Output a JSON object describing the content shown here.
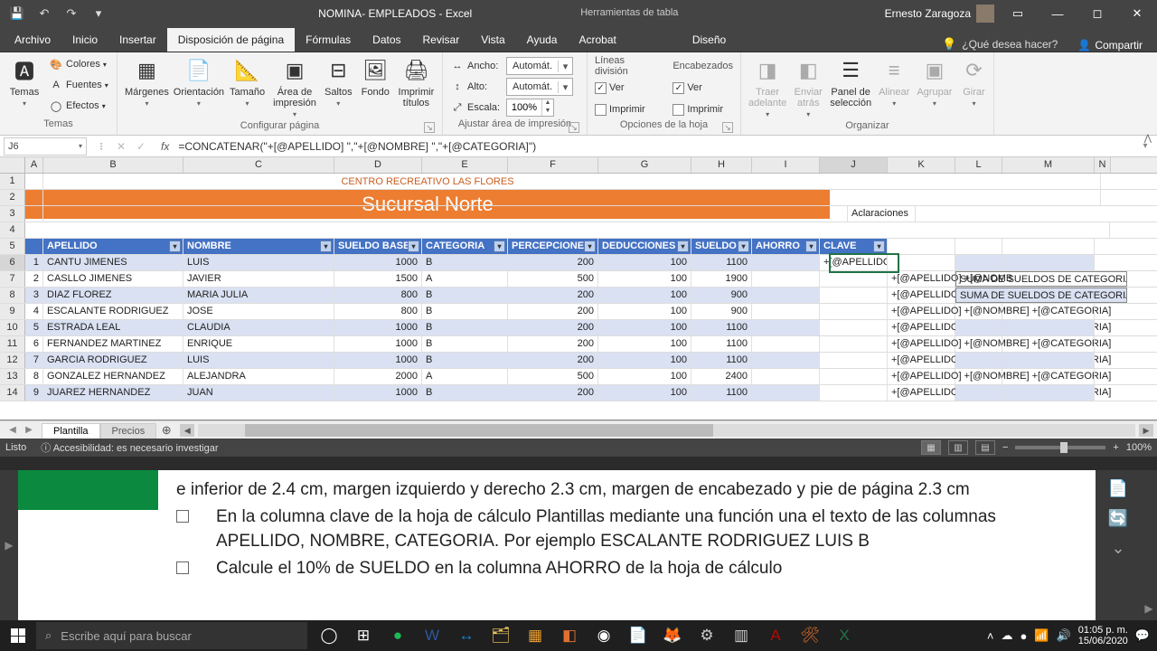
{
  "title": "NOMINA- EMPLEADOS - Excel",
  "tabTools": "Herramientas de tabla",
  "user": "Ernesto Zaragoza",
  "ribbonTabs": {
    "file": "Archivo",
    "home": "Inicio",
    "insert": "Insertar",
    "pageLayout": "Disposición de página",
    "formulas": "Fórmulas",
    "data": "Datos",
    "review": "Revisar",
    "view": "Vista",
    "help": "Ayuda",
    "acrobat": "Acrobat",
    "design": "Diseño"
  },
  "tellMe": "¿Qué desea hacer?",
  "share": "Compartir",
  "ribbon": {
    "themes": {
      "label": "Temas",
      "themes": "Temas",
      "colors": "Colores",
      "fonts": "Fuentes",
      "effects": "Efectos"
    },
    "pageSetup": {
      "label": "Configurar página",
      "margins": "Márgenes",
      "orientation": "Orientación",
      "size": "Tamaño",
      "printArea": "Área de\nimpresión",
      "breaks": "Saltos",
      "background": "Fondo",
      "printTitles": "Imprimir\ntítulos"
    },
    "scaleToFit": {
      "label": "Ajustar área de impresión",
      "width": "Ancho:",
      "height": "Alto:",
      "scale": "Escala:",
      "auto": "Automát.",
      "scaleVal": "100%"
    },
    "sheetOptions": {
      "label": "Opciones de la hoja",
      "gridlines": "Líneas división",
      "headings": "Encabezados",
      "view": "Ver",
      "print": "Imprimir"
    },
    "arrange": {
      "label": "Organizar",
      "bringForward": "Traer\nadelante",
      "sendBackward": "Enviar\natrás",
      "selectionPane": "Panel de\nselección",
      "align": "Alinear",
      "group": "Agrupar",
      "rotate": "Girar"
    }
  },
  "nameBox": "J6",
  "formula": "=CONCATENAR(\"+[@APELLIDO] \",\"+[@NOMBRE] \",\"+[@CATEGORIA]\")",
  "cols": [
    "A",
    "B",
    "C",
    "D",
    "E",
    "F",
    "G",
    "H",
    "I",
    "J",
    "K",
    "L",
    "M",
    "N"
  ],
  "banner1": "CENTRO RECREATIVO LAS FLORES",
  "banner2": "Sucursal Norte",
  "aclaraciones": "Aclaraciones",
  "headers": {
    "apellido": "APELLIDO",
    "nombre": "NOMBRE",
    "sueldoBase": "SUELDO BASE",
    "categoria": "CATEGORIA",
    "percepciones": "PERCEPCIONES",
    "deducciones": "DEDUCCIONES",
    "sueldo": "SUELDO",
    "ahorro": "AHORRO",
    "clave": "CLAVE"
  },
  "sumaNote": "SUMA DE SUELDOS DE CATEGORIA",
  "data": [
    {
      "n": "1",
      "apellido": "CANTU JIMENES",
      "nombre": "LUIS",
      "sb": "1000",
      "cat": "B",
      "per": "200",
      "ded": "100",
      "sueldo": "1100",
      "clave": "+[@APELLIDO] +[@NOMBRE] +[@CATEGORIA]"
    },
    {
      "n": "2",
      "apellido": "CASLLO JIMENES",
      "nombre": "JAVIER",
      "sb": "1500",
      "cat": "A",
      "per": "500",
      "ded": "100",
      "sueldo": "1900",
      "clave": "+[@APELLIDO] +[@NOMB"
    },
    {
      "n": "3",
      "apellido": "DIAZ FLOREZ",
      "nombre": "MARIA JULIA",
      "sb": "800",
      "cat": "B",
      "per": "200",
      "ded": "100",
      "sueldo": "900",
      "clave": "+[@APELLIDO] +[@NOMB"
    },
    {
      "n": "4",
      "apellido": "ESCALANTE RODRIGUEZ",
      "nombre": "JOSE",
      "sb": "800",
      "cat": "B",
      "per": "200",
      "ded": "100",
      "sueldo": "900",
      "clave": "+[@APELLIDO] +[@NOMBRE] +[@CATEGORIA]"
    },
    {
      "n": "5",
      "apellido": "ESTRADA LEAL",
      "nombre": "CLAUDIA",
      "sb": "1000",
      "cat": "B",
      "per": "200",
      "ded": "100",
      "sueldo": "1100",
      "clave": "+[@APELLIDO] +[@NOMBRE] +[@CATEGORIA]"
    },
    {
      "n": "6",
      "apellido": "FERNANDEZ MARTINEZ",
      "nombre": "ENRIQUE",
      "sb": "1000",
      "cat": "B",
      "per": "200",
      "ded": "100",
      "sueldo": "1100",
      "clave": "+[@APELLIDO] +[@NOMBRE] +[@CATEGORIA]"
    },
    {
      "n": "7",
      "apellido": "GARCIA RODRIGUEZ",
      "nombre": "LUIS",
      "sb": "1000",
      "cat": "B",
      "per": "200",
      "ded": "100",
      "sueldo": "1100",
      "clave": "+[@APELLIDO] +[@NOMBRE] +[@CATEGORIA]"
    },
    {
      "n": "8",
      "apellido": "GONZALEZ HERNANDEZ",
      "nombre": "ALEJANDRA",
      "sb": "2000",
      "cat": "A",
      "per": "500",
      "ded": "100",
      "sueldo": "2400",
      "clave": "+[@APELLIDO] +[@NOMBRE] +[@CATEGORIA]"
    },
    {
      "n": "9",
      "apellido": "JUAREZ HERNANDEZ",
      "nombre": "JUAN",
      "sb": "1000",
      "cat": "B",
      "per": "200",
      "ded": "100",
      "sueldo": "1100",
      "clave": "+[@APELLIDO] +[@NOMBRE] +[@CATEGORIA]"
    }
  ],
  "sheets": {
    "plantilla": "Plantilla",
    "precios": "Precios"
  },
  "status": {
    "ready": "Listo",
    "accessibility": "Accesibilidad: es necesario investigar",
    "zoom": "100%"
  },
  "instructions": {
    "line0": "e inferior de 2.4 cm, margen izquierdo y derecho 2.3 cm, margen de encabezado y pie de página 2.3 cm",
    "line1": "En la columna clave de la hoja de cálculo Plantillas mediante una función una el texto de las columnas APELLIDO, NOMBRE, CATEGORIA. Por ejemplo ESCALANTE RODRIGUEZ LUIS B",
    "line2": "Calcule el 10% de SUELDO en la columna AHORRO de la hoja de cálculo"
  },
  "taskbar": {
    "search": "Escribe aquí para buscar",
    "time": "01:05 p. m.",
    "date": "15/06/2020"
  }
}
